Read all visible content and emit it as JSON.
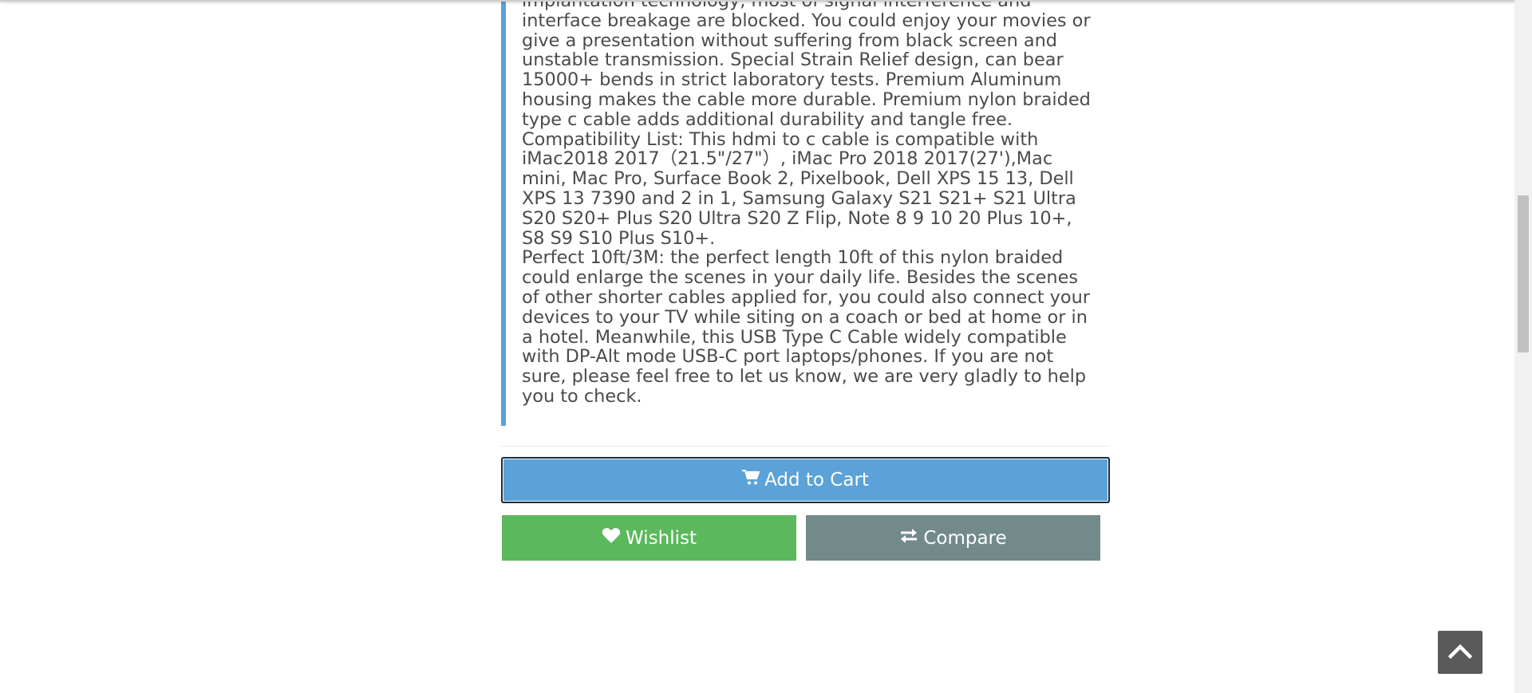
{
  "product": {
    "description_paragraphs": [
      "implantation technology, most of signal interference and interface breakage are blocked. You could enjoy your movies or give a presentation without suffering from black screen and unstable transmission. Special Strain Relief design, can bear 15000+ bends in strict laboratory tests. Premium Aluminum housing makes the cable more durable. Premium nylon braided type c cable adds additional durability and tangle free.",
      "Compatibility List: This hdmi to c cable is compatible with iMac2018 2017（21.5\"/27\"）, iMac Pro 2018 2017(27'),Mac mini, Mac Pro, Surface Book 2, Pixelbook, Dell XPS 15 13, Dell XPS 13 7390 and 2 in 1, Samsung Galaxy S21 S21+ S21 Ultra S20 S20+ Plus S20 Ultra S20 Z Flip, Note 8 9 10 20 Plus 10+, S8 S9 S10 Plus S10+.",
      "Perfect 10ft/3M: the perfect length 10ft of this nylon braided could enlarge the scenes in your daily life. Besides the scenes of other shorter cables applied for, you could also connect your devices to your TV while siting on a coach or bed at home or in a hotel. Meanwhile, this USB Type C Cable widely compatible with DP-Alt mode USB-C port laptops/phones. If you are not sure, please feel free to let us know, we are very gladly to help you to check."
    ]
  },
  "actions": {
    "add_to_cart_label": "Add to Cart",
    "add_to_cart_icon": "cart-icon",
    "wishlist_label": "Wishlist",
    "wishlist_icon": "heart-icon",
    "compare_label": "Compare",
    "compare_icon": "exchange-icon"
  },
  "scroll_top": {
    "icon": "chevron-up-icon"
  },
  "colors": {
    "cart_button": "#5aa2d8",
    "wishlist_button": "#5cb85c",
    "compare_button": "#738a8b",
    "description_border": "#5aa2d8",
    "text": "#4b4b4b",
    "scroll_top_button": "#5a5a5a"
  }
}
